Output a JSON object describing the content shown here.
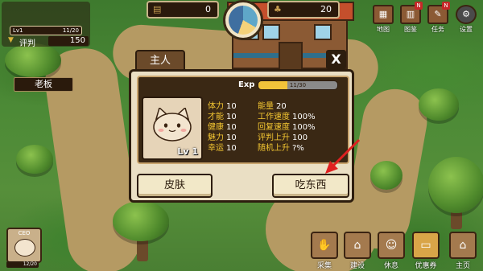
{
  "hud": {
    "level_label": "Lv1",
    "level_progress": "11/20",
    "rating_label": "评判",
    "rating_value": "150",
    "resource_1": "0",
    "resource_2": "20"
  },
  "top_menu": [
    {
      "label": "地图",
      "icon": "map-icon",
      "badge": ""
    },
    {
      "label": "图鉴",
      "icon": "book-icon",
      "badge": "N"
    },
    {
      "label": "任务",
      "icon": "quest-icon",
      "badge": "N"
    },
    {
      "label": "设置",
      "icon": "gear-icon",
      "badge": ""
    }
  ],
  "bottom_menu": [
    {
      "label": "采集",
      "icon": "gather-icon"
    },
    {
      "label": "建设",
      "icon": "build-icon"
    },
    {
      "label": "休息",
      "icon": "rest-icon"
    },
    {
      "label": "优惠券",
      "icon": "coupon-icon"
    },
    {
      "label": "主页",
      "icon": "home-icon"
    }
  ],
  "ceo": {
    "label": "CEO",
    "progress": "12/20"
  },
  "modal": {
    "tab_title": "主人",
    "close_label": "X",
    "name": "老板",
    "exp_label": "Exp",
    "exp_text": "11/30",
    "exp_fraction": 0.367,
    "level": "Lv 1",
    "stats_left": [
      {
        "label": "体力",
        "value": "10"
      },
      {
        "label": "才能",
        "value": "10"
      },
      {
        "label": "健康",
        "value": "10"
      },
      {
        "label": "魅力",
        "value": "10"
      },
      {
        "label": "幸运",
        "value": "10"
      }
    ],
    "stats_right": [
      {
        "label": "能量",
        "value": "20"
      },
      {
        "label": "工作速度",
        "value": "100%"
      },
      {
        "label": "回复速度",
        "value": "100%"
      },
      {
        "label": "评判上升",
        "value": "100"
      },
      {
        "label": "随机上升",
        "value": "?%"
      }
    ],
    "skin_button": "皮肤",
    "eat_button": "吃东西"
  },
  "colors": {
    "stat_label": "#f5c832",
    "annotation_arrow": "#e02020"
  }
}
